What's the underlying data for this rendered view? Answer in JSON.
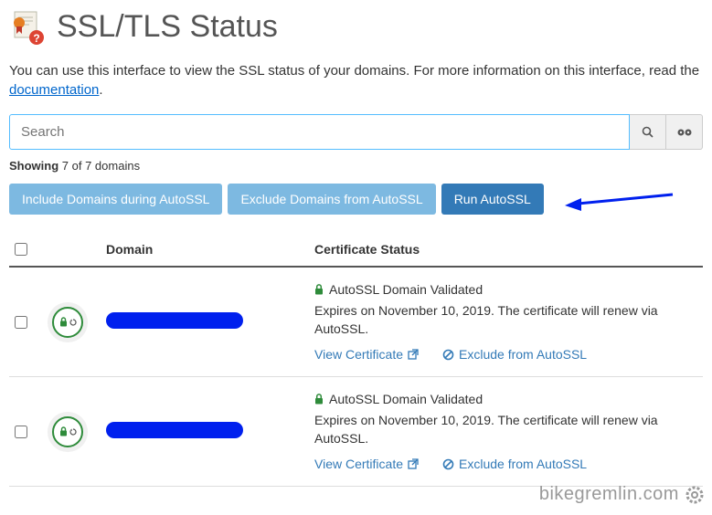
{
  "header": {
    "title": "SSL/TLS Status"
  },
  "intro": {
    "text_before": "You can use this interface to view the SSL status of your domains. For more information on this interface, read the ",
    "link_text": "documentation",
    "text_after": "."
  },
  "search": {
    "placeholder": "Search"
  },
  "count": {
    "label": "Showing",
    "value": "7 of 7 domains"
  },
  "buttons": {
    "include": "Include Domains during AutoSSL",
    "exclude": "Exclude Domains from AutoSSL",
    "run": "Run AutoSSL"
  },
  "table": {
    "head_domain": "Domain",
    "head_status": "Certificate Status",
    "rows": [
      {
        "status_label": "AutoSSL Domain Validated",
        "expires": "Expires on November 10, 2019. The certificate will renew via AutoSSL.",
        "view_cert": "View Certificate",
        "exclude": "Exclude from AutoSSL"
      },
      {
        "status_label": "AutoSSL Domain Validated",
        "expires": "Expires on November 10, 2019. The certificate will renew via AutoSSL.",
        "view_cert": "View Certificate",
        "exclude": "Exclude from AutoSSL"
      }
    ]
  },
  "watermark": "bikegremlin.com"
}
